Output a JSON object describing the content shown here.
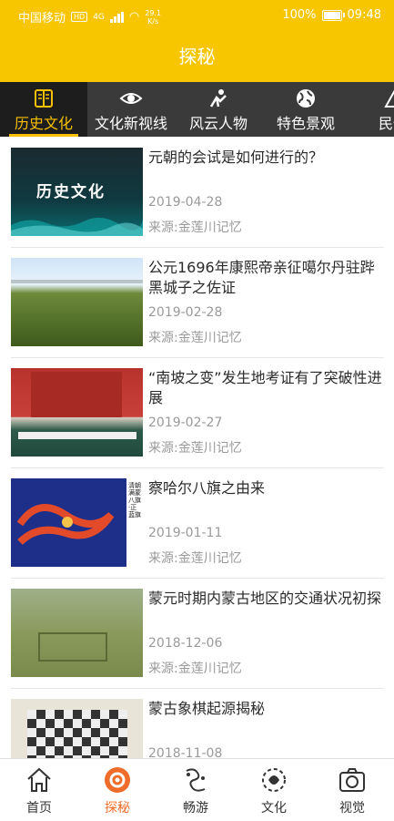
{
  "status_bar": {
    "carrier": "中国移动",
    "hd": "HD",
    "net": "4G",
    "speed_value": "29.1",
    "speed_unit": "K/s",
    "battery": "100%",
    "time": "09:48"
  },
  "header": {
    "title": "探秘"
  },
  "tabs": [
    {
      "label": "历史文化",
      "icon": "book-icon"
    },
    {
      "label": "文化新视线",
      "icon": "eye-icon"
    },
    {
      "label": "风云人物",
      "icon": "figure-icon"
    },
    {
      "label": "特色景观",
      "icon": "globe-icon"
    },
    {
      "label": "民俗",
      "icon": "folk-icon"
    }
  ],
  "articles": [
    {
      "title": "元朝的会试是如何进行的？",
      "date": "2019-04-28",
      "source": "来源:金莲川记忆",
      "thumb_text": "历史文化"
    },
    {
      "title": "公元1696年康熙帝亲征噶尔丹驻跸黑城子之佐证",
      "date": "2019-02-28",
      "source": "来源:金莲川记忆"
    },
    {
      "title": "“南坡之变”发生地考证有了突破性进展",
      "date": "2019-02-27",
      "source": "来源:金莲川记忆"
    },
    {
      "title": "察哈尔八旗之由来",
      "date": "2019-01-11",
      "source": "来源:金莲川记忆",
      "thumb_text": "清朝满蒙八旗·正蓝旗"
    },
    {
      "title": "蒙元时期内蒙古地区的交通状况初探",
      "date": "2018-12-06",
      "source": "来源:金莲川记忆"
    },
    {
      "title": "蒙古象棋起源揭秘",
      "date": "2018-11-08",
      "source": ""
    }
  ],
  "bottom_nav": [
    {
      "label": "首页",
      "icon": "home-icon"
    },
    {
      "label": "探秘",
      "icon": "explore-icon"
    },
    {
      "label": "畅游",
      "icon": "travel-icon"
    },
    {
      "label": "文化",
      "icon": "culture-icon"
    },
    {
      "label": "视觉",
      "icon": "camera-icon"
    }
  ],
  "colors": {
    "accent": "#f7c600",
    "tab_bar": "#3a3a3a",
    "active_tab": "#f6c000",
    "nav_active": "#ef6c2a"
  }
}
